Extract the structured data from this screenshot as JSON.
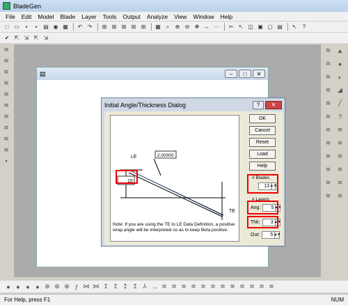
{
  "app": {
    "title": "BladeGen"
  },
  "menu": [
    "File",
    "Edit",
    "Model",
    "Blade",
    "Layer",
    "Tools",
    "Output",
    "Analyze",
    "View",
    "Window",
    "Help"
  ],
  "toolbar1_icons": [
    "new-icon",
    "open-icon",
    "save-icon",
    "save-as-icon",
    "print-icon",
    "binoculars-icon",
    "grid-icon",
    "undo-icon",
    "redo-icon",
    "view1-icon",
    "view2-icon",
    "view3-icon",
    "view4-icon",
    "view5-icon",
    "zoom-icon",
    "zoom-in-icon",
    "zoom-out-icon",
    "fit-icon",
    "move-icon",
    "dots-icon",
    "cut-icon",
    "pointer-icon",
    "cube-icon",
    "3d-icon",
    "2d-icon",
    "td-icon",
    "help-pointer-icon",
    "question-icon"
  ],
  "toolbar2_icons": [
    "check-icon",
    "tool1-icon",
    "tool2-icon",
    "tool3-icon",
    "tool4-icon"
  ],
  "child_window": {
    "icon_name": "document-icon",
    "buttons": [
      "–",
      "□",
      "✕"
    ]
  },
  "dialog": {
    "title": "Initial Angle/Thickness Dialog",
    "help_btn": "?",
    "close_btn": "✕",
    "buttons": {
      "ok": "OK",
      "cancel": "Cancel",
      "reset": "Reset",
      "load": "Load",
      "help": "Help"
    },
    "blades_label": "# Blades",
    "blades_value": "13",
    "layers_label": "# Layers",
    "ang_label": "Ang:",
    "ang_value": "5",
    "thk_label": "Thk:",
    "thk_value": "3",
    "out_label": "Out:",
    "out_value": "5",
    "le_label": "LE",
    "te_label": "TE",
    "thickness_value": "2.00000",
    "angle_value": "15",
    "note": "Note: If you are using the TE to LE Data Definition, a positive wrap angle will be interpreted so as to keep Beta positive."
  },
  "status": {
    "left": "For Help, press F1",
    "right": "NUM"
  }
}
